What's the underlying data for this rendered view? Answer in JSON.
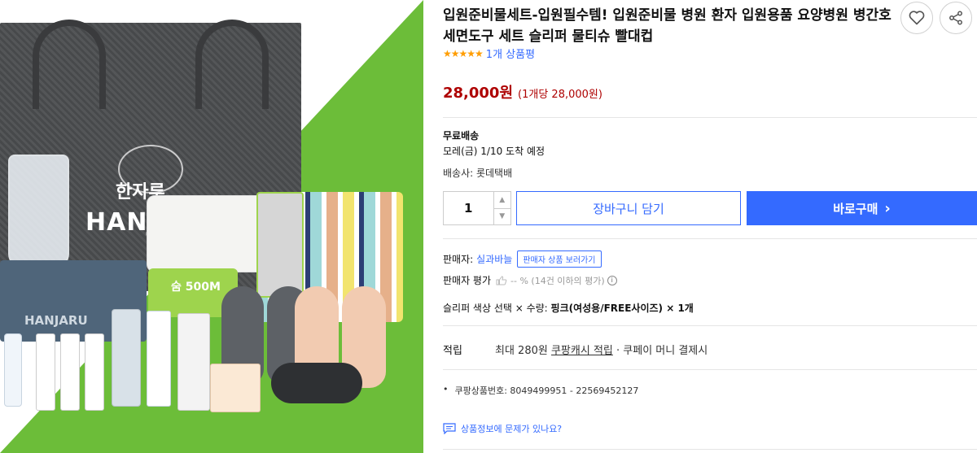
{
  "product": {
    "title": "입원준비물세트-입원필수템! 입원준비물 병원 환자 입원용품 요양병원 병간호 세면도구 세트 슬리퍼 물티슈 빨대컵",
    "stars": "★★★★★",
    "review_count": "1개 상품평",
    "price": "28,000원",
    "unit_price": "(1개당 28,000원)"
  },
  "image": {
    "bag_brand_ko": "한자루",
    "bag_brand_en": "HANJARU",
    "towel_brand": "HANJARU",
    "wipe_label": "숨 500M",
    "colors": {
      "green": "#6cbd39",
      "bag": "#4b4d4f"
    }
  },
  "shipping": {
    "type": "무료배송",
    "eta": "모레(금) 1/10 도착 예정",
    "carrier": "배송사: 롯데택배"
  },
  "purchase": {
    "quantity": "1",
    "up_arrow": "▲",
    "down_arrow": "▼",
    "cart_label": "장바구니 담기",
    "buy_label": "바로구매",
    "buy_chevron": "›"
  },
  "seller": {
    "label": "판매자:",
    "name": "실과바늘",
    "view_products": "판매자 상품 보러가기",
    "rating_label": "판매자 평가",
    "rating_value": "-- % (14건 이하의 평가)",
    "info_icon": "i"
  },
  "option": {
    "text_prefix": "슬리퍼 색상 선택 × 수량: ",
    "text_value": "핑크(여성용/FREE사이즈) × 1개"
  },
  "reward": {
    "label": "적립",
    "prefix": "최대 280원 ",
    "link": "쿠팡캐시 적립",
    "suffix": " · 쿠페이 머니 결제시"
  },
  "details": {
    "product_number": "쿠팡상품번호: 8049499951 - 22569452127",
    "report_problem": "상품정보에 문제가 있나요?"
  },
  "colors": {
    "accent": "#346aff",
    "price": "#ae0000",
    "star": "#ff9d00"
  }
}
